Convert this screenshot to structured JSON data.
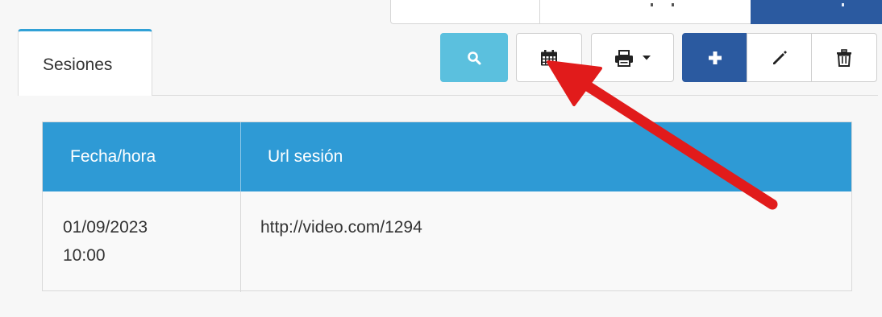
{
  "tab": {
    "label": "Sesiones"
  },
  "toolbar": {
    "search_icon": "search-icon",
    "calendar_icon": "calendar-icon",
    "print_icon": "print-icon",
    "add_icon": "plus-icon",
    "edit_icon": "pencil-icon",
    "delete_icon": "trash-icon"
  },
  "table": {
    "headers": [
      "Fecha/hora",
      "Url sesión"
    ],
    "rows": [
      {
        "fecha_line1": "01/09/2023",
        "fecha_line2": "10:00",
        "url": "http://video.com/1294"
      }
    ]
  },
  "colors": {
    "header_bg": "#2e9ad5",
    "search_button": "#5bc0de",
    "add_button": "#2b5aa0",
    "tab_accent": "#31a1d6",
    "annotation_arrow": "#e11b1b"
  }
}
